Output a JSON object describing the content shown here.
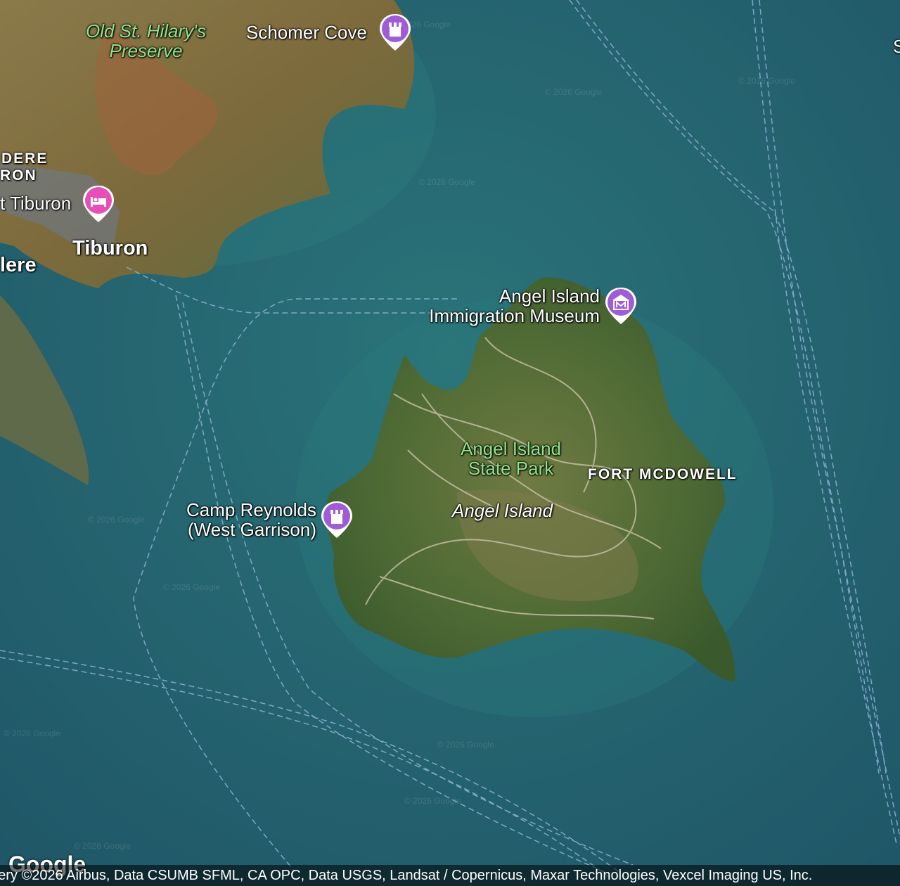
{
  "map": {
    "labels": {
      "old_st_hilarys": "Old St. Hilary's\nPreserve",
      "schomer_cove": "Schomer Cove",
      "belvedere_1": "DERE",
      "belvedere_2": "RON",
      "lodge_tiburon": "t Tiburon",
      "tiburon": "Tiburon",
      "belvedere_town": "lere",
      "angel_museum": "Angel Island\nImmigration Museum",
      "state_park": "Angel Island\nState Park",
      "fort_mcdowell": "FORT MCDOWELL",
      "angel_island": "Angel Island",
      "camp_reynolds": "Camp Reynolds\n(West Garrison)",
      "edge_letter": "S"
    },
    "pins": {
      "schomer_cove": {
        "type": "landmark",
        "color": "#a05bd6",
        "icon": "castle-icon"
      },
      "lodge": {
        "type": "hotel",
        "color": "#e84fb6",
        "icon": "bed-icon"
      },
      "museum": {
        "type": "museum",
        "color": "#a05bd6",
        "icon": "museum-icon"
      },
      "camp_reynolds": {
        "type": "landmark",
        "color": "#a05bd6",
        "icon": "castle-icon"
      }
    },
    "watermark": "© 2026 Google",
    "google_logo": "Google",
    "attribution": "gery ©2026 Airbus, Data CSUMB SFML, CA OPC, Data USGS, Landsat / Copernicus, Maxar Technologies, Vexcel Imaging US, Inc."
  }
}
